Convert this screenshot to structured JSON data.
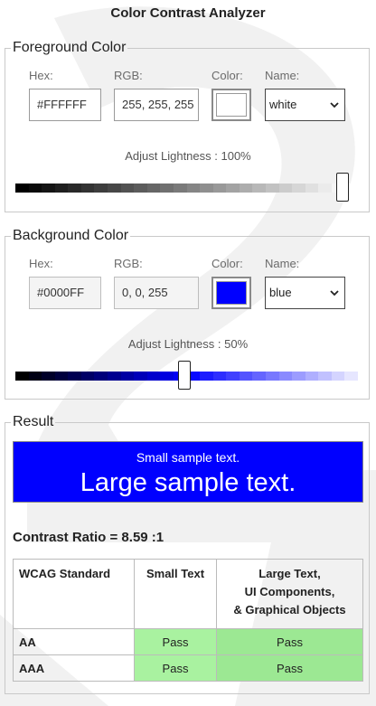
{
  "app": {
    "title": "Color Contrast Analyzer"
  },
  "labels": {
    "hex": "Hex:",
    "rgb": "RGB:",
    "color": "Color:",
    "name": "Name:"
  },
  "foreground": {
    "legend": "Foreground Color",
    "hex": "#FFFFFF",
    "rgb": "255, 255, 255",
    "swatch_color": "#FFFFFF",
    "name": "white",
    "adjust_label": "Adjust Lightness : 100%",
    "lightness": 1.0
  },
  "background": {
    "legend": "Background Color",
    "hex": "#0000FF",
    "rgb": "0, 0, 255",
    "swatch_color": "#0000FF",
    "name": "blue",
    "adjust_label": "Adjust Lightness : 50%",
    "lightness": 0.5
  },
  "result": {
    "legend": "Result",
    "small_sample": "Small sample text.",
    "large_sample": "Large sample text.",
    "contrast_label": "Contrast Ratio = 8.59 :1",
    "table": {
      "headers": [
        "WCAG Standard",
        "Small Text",
        "Large Text,\nUI Components,\n& Graphical Objects"
      ],
      "header_lines": [
        "Large Text,",
        "UI Components,",
        "& Graphical Objects"
      ],
      "rows": [
        {
          "level": "AA",
          "small": "Pass",
          "large": "Pass"
        },
        {
          "level": "AAA",
          "small": "Pass",
          "large": "Pass"
        }
      ]
    },
    "pass_color": "#9CE893"
  }
}
